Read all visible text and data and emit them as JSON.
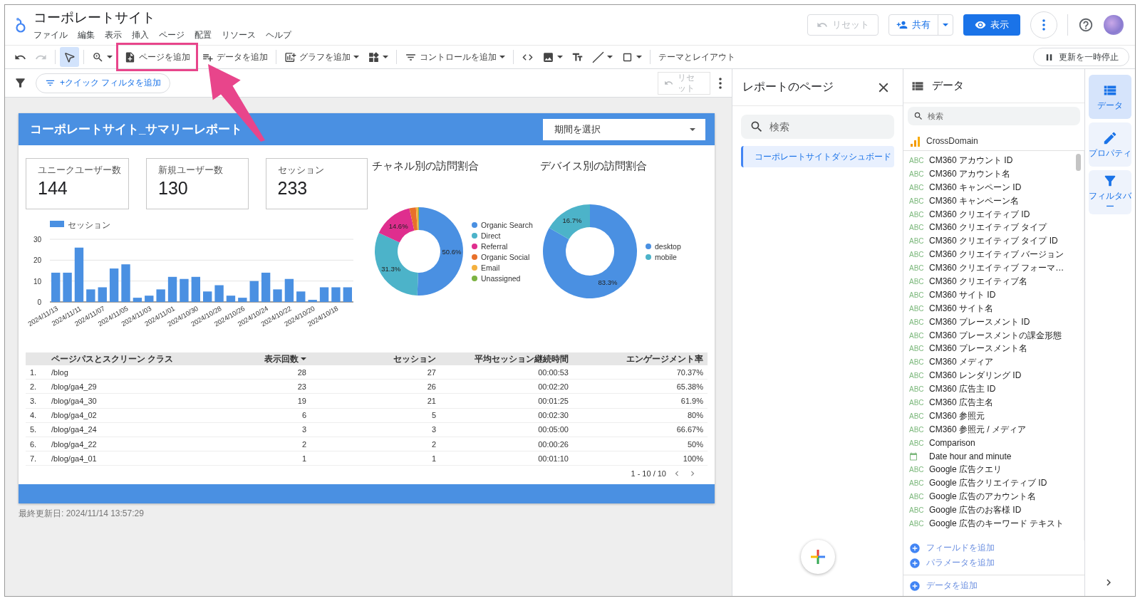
{
  "header": {
    "title": "コーポレートサイト",
    "menus": [
      "ファイル",
      "編集",
      "表示",
      "挿入",
      "ページ",
      "配置",
      "リソース",
      "ヘルプ"
    ],
    "reset_button": {
      "label": "リセット",
      "disabled": true
    },
    "share_button": {
      "label": "共有"
    },
    "view_button": {
      "label": "表示"
    }
  },
  "toolbar": {
    "items": [
      {
        "kind": "tool",
        "disabled": false,
        "selected": false,
        "dropdown": false,
        "highlighted": false
      },
      {
        "kind": "tool",
        "disabled": true,
        "selected": false,
        "dropdown": false,
        "highlighted": false
      },
      {
        "kind": "tool",
        "disabled": false,
        "selected": true,
        "dropdown": false,
        "highlighted": false
      },
      {
        "kind": "tool",
        "disabled": false,
        "selected": false,
        "dropdown": true,
        "highlighted": false
      },
      {
        "kind": "button",
        "label": "ページを追加",
        "disabled": false,
        "selected": false,
        "dropdown": false,
        "highlighted": true
      },
      {
        "kind": "button",
        "label": "データを追加",
        "disabled": false,
        "selected": false,
        "dropdown": false,
        "highlighted": false
      },
      {
        "kind": "button",
        "label": "グラフを追加",
        "disabled": false,
        "selected": false,
        "dropdown": true,
        "highlighted": false
      },
      {
        "kind": "tool",
        "disabled": false,
        "selected": false,
        "dropdown": true,
        "highlighted": false
      },
      {
        "kind": "button",
        "label": "コントロールを追加",
        "disabled": false,
        "selected": false,
        "dropdown": true,
        "highlighted": false
      },
      {
        "kind": "tool",
        "disabled": false,
        "selected": false,
        "dropdown": false,
        "highlighted": false
      },
      {
        "kind": "tool",
        "disabled": false,
        "selected": false,
        "dropdown": true,
        "highlighted": false
      },
      {
        "kind": "tool",
        "disabled": false,
        "selected": false,
        "dropdown": false,
        "highlighted": false
      },
      {
        "kind": "tool",
        "disabled": false,
        "selected": false,
        "dropdown": true,
        "highlighted": false
      },
      {
        "kind": "tool",
        "disabled": false,
        "selected": false,
        "dropdown": true,
        "highlighted": false
      },
      {
        "kind": "text",
        "label": "テーマとレイアウト",
        "disabled": false,
        "selected": false,
        "dropdown": false,
        "highlighted": false
      }
    ],
    "pause_button": {
      "label": "更新を一時停止"
    }
  },
  "filter_bar": {
    "quick_filter": "+クイック フィルタを追加",
    "reset_button": {
      "label": "リセット",
      "disabled": true
    }
  },
  "report": {
    "title": "コーポレートサイト_サマリーレポート",
    "date_picker": {
      "placeholder": "期間を選択"
    },
    "scorecards": [
      {
        "label": "ユニークユーザー数",
        "value": "144"
      },
      {
        "label": "新規ユーザー数",
        "value": "130"
      },
      {
        "label": "セッション",
        "value": "233"
      }
    ],
    "session_chart": {
      "chart_data": {
        "type": "bar",
        "ylim": [
          0,
          30
        ],
        "yticks": [
          0,
          10,
          20,
          30
        ],
        "legend": "top",
        "categories": [
          "2024/11/13",
          null,
          "2024/11/11",
          null,
          "2024/11/07",
          null,
          "2024/11/05",
          null,
          "2024/11/03",
          null,
          "2024/11/01",
          null,
          "2024/10/30",
          null,
          "2024/10/28",
          null,
          "2024/10/26",
          null,
          "2024/10/24",
          null,
          "2024/10/22",
          null,
          "2024/10/20",
          null,
          "2024/10/18",
          null
        ],
        "series": [
          {
            "name": "セッション",
            "color": "#4a90e2",
            "values": [
              14,
              14,
              26,
              6,
              7,
              16,
              18,
              2,
              3,
              6,
              12,
              11,
              12,
              5,
              8,
              3,
              2,
              10,
              14,
              6,
              11,
              5,
              1,
              7,
              7,
              7
            ]
          }
        ]
      }
    },
    "channel_chart": {
      "chart_data": {
        "type": "donut",
        "legend": "right",
        "title": "チャネル別の訪問割合",
        "categories": [
          "Organic Search",
          "Direct",
          "Referral",
          "Organic Social",
          "Email",
          "Unassigned"
        ],
        "values": [
          50.6,
          31.3,
          14.6,
          2.4,
          0.8,
          0.3
        ],
        "colors": [
          "#4a90e2",
          "#4cb3c9",
          "#df2e8e",
          "#e8702a",
          "#f4b03e",
          "#7cb342"
        ],
        "value_labels": [
          "50.6%",
          "31.3%",
          "14.6%",
          null,
          null,
          null
        ]
      }
    },
    "device_chart": {
      "chart_data": {
        "type": "donut",
        "legend": "right",
        "title": "デバイス別の訪問割合",
        "categories": [
          "desktop",
          "mobile"
        ],
        "values": [
          83.3,
          16.7
        ],
        "colors": [
          "#4a90e2",
          "#4cb3c9"
        ],
        "value_labels": [
          "83.3%",
          "16.7%"
        ]
      }
    },
    "table": {
      "columns": [
        {
          "label": "ページパスとスクリーン クラス",
          "sorted": false
        },
        {
          "label": "表示回数",
          "sorted": true
        },
        {
          "label": "セッション",
          "sorted": false
        },
        {
          "label": "平均セッション継続時間",
          "sorted": false
        },
        {
          "label": "エンゲージメント率",
          "sorted": false
        }
      ],
      "rows": [
        {
          "index": "1.",
          "cells": [
            "/blog",
            "28",
            "27",
            "00:00:53",
            "70.37%"
          ]
        },
        {
          "index": "2.",
          "cells": [
            "/blog/ga4_29",
            "23",
            "26",
            "00:02:20",
            "65.38%"
          ]
        },
        {
          "index": "3.",
          "cells": [
            "/blog/ga4_30",
            "19",
            "21",
            "00:01:25",
            "61.9%"
          ]
        },
        {
          "index": "4.",
          "cells": [
            "/blog/ga4_02",
            "6",
            "5",
            "00:02:30",
            "80%"
          ]
        },
        {
          "index": "5.",
          "cells": [
            "/blog/ga4_24",
            "3",
            "3",
            "00:05:00",
            "66.67%"
          ]
        },
        {
          "index": "6.",
          "cells": [
            "/blog/ga4_22",
            "2",
            "2",
            "00:00:26",
            "50%"
          ]
        },
        {
          "index": "7.",
          "cells": [
            "/blog/ga4_01",
            "1",
            "1",
            "00:01:10",
            "100%"
          ]
        }
      ],
      "pagination": "1 - 10 / 10"
    },
    "last_updated": "最終更新日: 2024/11/14 13:57:29"
  },
  "pages_panel": {
    "title": "レポートのページ",
    "search": {
      "placeholder": "検索"
    },
    "pages": [
      {
        "label": "コーポレートサイトダッシュボード",
        "selected": true
      }
    ]
  },
  "data_panel": {
    "title": "データ",
    "search": {
      "placeholder": "検索"
    },
    "source": "CrossDomain",
    "fields": [
      {
        "kind": "text",
        "badge": "ABC",
        "label": "CM360 アカウント ID"
      },
      {
        "kind": "text",
        "badge": "ABC",
        "label": "CM360 アカウント名"
      },
      {
        "kind": "text",
        "badge": "ABC",
        "label": "CM360 キャンペーン ID"
      },
      {
        "kind": "text",
        "badge": "ABC",
        "label": "CM360 キャンペーン名"
      },
      {
        "kind": "text",
        "badge": "ABC",
        "label": "CM360 クリエイティブ ID"
      },
      {
        "kind": "text",
        "badge": "ABC",
        "label": "CM360 クリエイティブ タイプ"
      },
      {
        "kind": "text",
        "badge": "ABC",
        "label": "CM360 クリエイティブ タイプ ID"
      },
      {
        "kind": "text",
        "badge": "ABC",
        "label": "CM360 クリエイティブ バージョン"
      },
      {
        "kind": "text",
        "badge": "ABC",
        "label": "CM360 クリエイティブ フォーマ…"
      },
      {
        "kind": "text",
        "badge": "ABC",
        "label": "CM360 クリエイティブ名"
      },
      {
        "kind": "text",
        "badge": "ABC",
        "label": "CM360 サイト ID"
      },
      {
        "kind": "text",
        "badge": "ABC",
        "label": "CM360 サイト名"
      },
      {
        "kind": "text",
        "badge": "ABC",
        "label": "CM360 プレースメント ID"
      },
      {
        "kind": "text",
        "badge": "ABC",
        "label": "CM360 プレースメントの課金形態"
      },
      {
        "kind": "text",
        "badge": "ABC",
        "label": "CM360 プレースメント名"
      },
      {
        "kind": "text",
        "badge": "ABC",
        "label": "CM360 メディア"
      },
      {
        "kind": "text",
        "badge": "ABC",
        "label": "CM360 レンダリング ID"
      },
      {
        "kind": "text",
        "badge": "ABC",
        "label": "CM360 広告主 ID"
      },
      {
        "kind": "text",
        "badge": "ABC",
        "label": "CM360 広告主名"
      },
      {
        "kind": "text",
        "badge": "ABC",
        "label": "CM360 参照元"
      },
      {
        "kind": "text",
        "badge": "ABC",
        "label": "CM360 参照元 / メディア"
      },
      {
        "kind": "text",
        "badge": "ABC",
        "label": "Comparison"
      },
      {
        "kind": "date",
        "label": "Date hour and minute"
      },
      {
        "kind": "text",
        "badge": "ABC",
        "label": "Google 広告クエリ"
      },
      {
        "kind": "text",
        "badge": "ABC",
        "label": "Google 広告クリエイティブ ID"
      },
      {
        "kind": "text",
        "badge": "ABC",
        "label": "Google 広告のアカウント名"
      },
      {
        "kind": "text",
        "badge": "ABC",
        "label": "Google 広告のお客様 ID"
      },
      {
        "kind": "text",
        "badge": "ABC",
        "label": "Google 広告のキーワード テキスト"
      }
    ],
    "actions": [
      "フィールドを追加",
      "パラメータを追加"
    ],
    "add_data": "データを追加"
  },
  "rail": {
    "buttons": [
      {
        "label": "データ",
        "selected": true
      },
      {
        "label": "プロパティ",
        "selected": false
      },
      {
        "label": "フィルタバー",
        "selected": false
      }
    ]
  }
}
